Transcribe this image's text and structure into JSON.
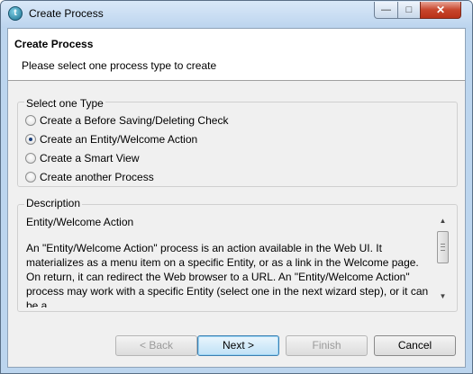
{
  "window": {
    "title": "Create Process",
    "app_icon": "talend-icon",
    "controls": {
      "minimize": "minimize-icon",
      "maximize": "maximize-icon",
      "close": "close-icon"
    }
  },
  "header": {
    "title": "Create Process",
    "subtitle": "Please select one process type to create"
  },
  "type_group": {
    "legend": "Select one Type",
    "options": [
      {
        "label": "Create a Before Saving/Deleting Check",
        "selected": false
      },
      {
        "label": "Create an Entity/Welcome Action",
        "selected": true
      },
      {
        "label": "Create a Smart View",
        "selected": false
      },
      {
        "label": "Create another Process",
        "selected": false
      }
    ]
  },
  "description_group": {
    "legend": "Description",
    "heading": "Entity/Welcome Action",
    "body": "An \"Entity/Welcome Action\" process is an action available in the Web UI. It materializes as a menu item on a specific Entity, or as a link in the Welcome page. On return, it can redirect the Web browser to a URL. An \"Entity/Welcome Action\" process may work with a specific Entity (select one in the next wizard step), or it can be a"
  },
  "buttons": {
    "back": "< Back",
    "next": "Next >",
    "finish": "Finish",
    "cancel": "Cancel"
  }
}
